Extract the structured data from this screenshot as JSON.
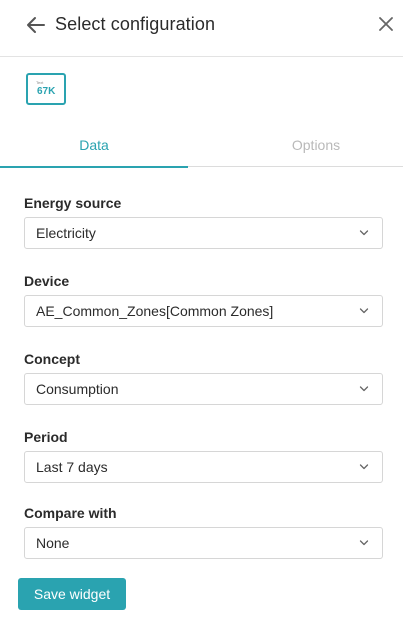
{
  "header": {
    "title": "Select configuration"
  },
  "widget_preview": {
    "small_label": "Text",
    "value": "67K"
  },
  "tabs": [
    {
      "label": "Data",
      "active": true
    },
    {
      "label": "Options",
      "active": false
    }
  ],
  "form": {
    "energy_source": {
      "label": "Energy source",
      "value": "Electricity"
    },
    "device": {
      "label": "Device",
      "value": "AE_Common_Zones[Common Zones]"
    },
    "concept": {
      "label": "Concept",
      "value": "Consumption"
    },
    "period": {
      "label": "Period",
      "value": "Last 7 days"
    },
    "compare_with": {
      "label": "Compare with",
      "value": "None"
    }
  },
  "actions": {
    "save_label": "Save widget"
  },
  "colors": {
    "accent": "#2aa3b0",
    "inactive_tab": "#b9b9b9",
    "border": "#d6d6d6"
  },
  "icons": {
    "back": "arrow-left-icon",
    "close": "close-icon",
    "dropdown": "chevron-down-icon"
  }
}
